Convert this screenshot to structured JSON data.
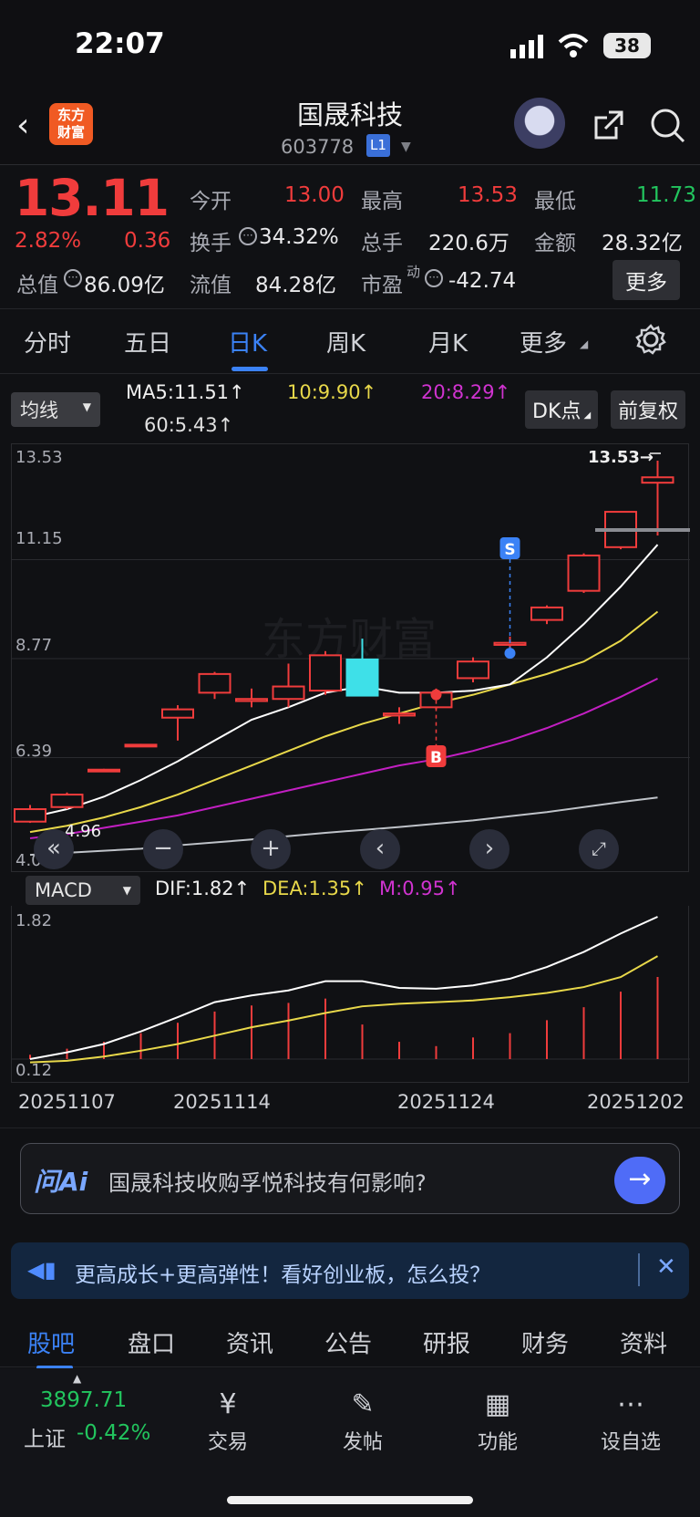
{
  "status": {
    "time": "22:07",
    "battery": "38"
  },
  "header": {
    "title": "国晟科技",
    "code": "603778",
    "level": "L1",
    "logo_text": "东方\n财富"
  },
  "quote": {
    "price": "13.11",
    "pct": "2.82%",
    "change": "0.36",
    "open_label": "今开",
    "open": "13.00",
    "high_label": "最高",
    "high": "13.53",
    "low_label": "最低",
    "low": "11.73",
    "turnover_label": "换手",
    "turnover": "34.32%",
    "volume_label": "总手",
    "volume": "220.6万",
    "amount_label": "金额",
    "amount": "28.32亿",
    "mcap_label": "总值",
    "mcap": "86.09亿",
    "float_label": "流值",
    "float": "84.28亿",
    "pe_label": "市盈",
    "pe_sup": "动",
    "pe": "-42.74",
    "more": "更多"
  },
  "ktabs": [
    "分时",
    "五日",
    "日K",
    "周K",
    "月K",
    "更多"
  ],
  "controls": {
    "ma_select": "均线",
    "ma5": "MA5:11.51",
    "ma10": "10:9.90",
    "ma20": "20:8.29",
    "ma60": "60:5.43",
    "dk": "DK点",
    "fq": "前复权"
  },
  "chart_data": {
    "type": "candlestick",
    "price_axis": [
      "13.53",
      "11.15",
      "8.77",
      "6.39",
      "4.01"
    ],
    "ylim": [
      4.01,
      13.53
    ],
    "candles": [
      {
        "o": 5.15,
        "c": 4.85,
        "h": 5.25,
        "l": 4.82
      },
      {
        "o": 5.5,
        "c": 5.2,
        "h": 5.55,
        "l": 5.15
      },
      {
        "o": 6.1,
        "c": 6.08,
        "h": 6.12,
        "l": 6.05
      },
      {
        "o": 6.7,
        "c": 6.68,
        "h": 6.72,
        "l": 6.65
      },
      {
        "o": 7.55,
        "c": 7.35,
        "h": 7.65,
        "l": 6.8
      },
      {
        "o": 8.4,
        "c": 7.95,
        "h": 8.45,
        "l": 7.8
      },
      {
        "o": 7.8,
        "c": 7.75,
        "h": 8.05,
        "l": 7.6
      },
      {
        "o": 8.1,
        "c": 7.8,
        "h": 8.65,
        "l": 7.6
      },
      {
        "o": 8.85,
        "c": 8.0,
        "h": 8.95,
        "l": 7.9
      },
      {
        "o": 7.88,
        "c": 8.75,
        "h": 9.25,
        "l": 7.88
      },
      {
        "o": 7.45,
        "c": 7.4,
        "h": 7.6,
        "l": 7.2
      },
      {
        "o": 7.95,
        "c": 7.6,
        "h": 8.05,
        "l": 7.55
      },
      {
        "o": 8.7,
        "c": 8.3,
        "h": 8.8,
        "l": 8.2
      },
      {
        "o": 9.15,
        "c": 9.1,
        "h": 9.3,
        "l": 9.0
      },
      {
        "o": 10.0,
        "c": 9.7,
        "h": 10.05,
        "l": 9.6
      },
      {
        "o": 11.25,
        "c": 10.4,
        "h": 11.3,
        "l": 10.35
      },
      {
        "o": 12.3,
        "c": 11.45,
        "h": 12.3,
        "l": 11.4
      },
      {
        "o": 13.13,
        "c": 13.0,
        "h": 13.53,
        "l": 11.73
      }
    ],
    "ma5": [
      4.95,
      5.15,
      5.45,
      5.85,
      6.3,
      6.8,
      7.3,
      7.6,
      7.95,
      8.1,
      7.95,
      7.95,
      8.0,
      8.15,
      8.8,
      9.6,
      10.5,
      11.51
    ],
    "ma10": [
      4.6,
      4.75,
      4.95,
      5.2,
      5.5,
      5.85,
      6.2,
      6.55,
      6.9,
      7.2,
      7.45,
      7.7,
      7.9,
      8.15,
      8.4,
      8.7,
      9.2,
      9.9
    ],
    "ma20": [
      4.45,
      4.55,
      4.7,
      4.85,
      5.0,
      5.2,
      5.4,
      5.6,
      5.8,
      6.0,
      6.2,
      6.35,
      6.55,
      6.8,
      7.1,
      7.45,
      7.85,
      8.29
    ],
    "ma60": [
      4.05,
      4.1,
      4.15,
      4.2,
      4.28,
      4.35,
      4.42,
      4.5,
      4.58,
      4.65,
      4.72,
      4.8,
      4.88,
      4.98,
      5.08,
      5.2,
      5.32,
      5.43
    ],
    "marks": {
      "high_label": "13.53→",
      "low_label": "4.96",
      "buy": "B",
      "sell": "S"
    },
    "macd": {
      "dif": [
        0.12,
        0.2,
        0.3,
        0.45,
        0.62,
        0.8,
        0.88,
        0.94,
        1.05,
        1.05,
        0.97,
        0.96,
        1.0,
        1.08,
        1.22,
        1.4,
        1.62,
        1.82
      ],
      "dea": [
        0.08,
        0.1,
        0.15,
        0.22,
        0.3,
        0.4,
        0.5,
        0.58,
        0.67,
        0.75,
        0.78,
        0.8,
        0.82,
        0.86,
        0.91,
        0.98,
        1.1,
        1.35
      ],
      "m": [
        0.05,
        0.12,
        0.2,
        0.3,
        0.42,
        0.55,
        0.62,
        0.65,
        0.7,
        0.4,
        0.2,
        0.15,
        0.25,
        0.3,
        0.45,
        0.6,
        0.78,
        0.95
      ],
      "axis": [
        "1.82",
        "0.12"
      ],
      "ylim": [
        0.12,
        1.82
      ]
    },
    "dates": [
      "20251107",
      "20251114",
      "20251124",
      "20251202"
    ]
  },
  "macd_header": {
    "select": "MACD",
    "dif": "DIF:1.82",
    "dea": "DEA:1.35",
    "m": "M:0.95"
  },
  "ai": {
    "brand": "问Ai",
    "question": "国晟科技收购孚悦科技有何影响?"
  },
  "promo": {
    "text": "更高成长+更高弹性！看好创业板，怎么投？"
  },
  "subtabs": [
    "股吧",
    "盘口",
    "资讯",
    "公告",
    "研报",
    "财务",
    "资料"
  ],
  "bottom": {
    "index_value": "3897.71",
    "index_name": "上证",
    "index_pct": "-0.42%",
    "items": [
      "交易",
      "发帖",
      "功能",
      "设自选"
    ]
  },
  "colors": {
    "red": "#f03c3c",
    "green": "#22c55e",
    "cyan": "#3ee0e8",
    "ma5": "#ffffff",
    "ma10": "#e8d84a",
    "ma20": "#c21fc2",
    "ma60": "#bfc3c9",
    "accent": "#3b82f6"
  }
}
